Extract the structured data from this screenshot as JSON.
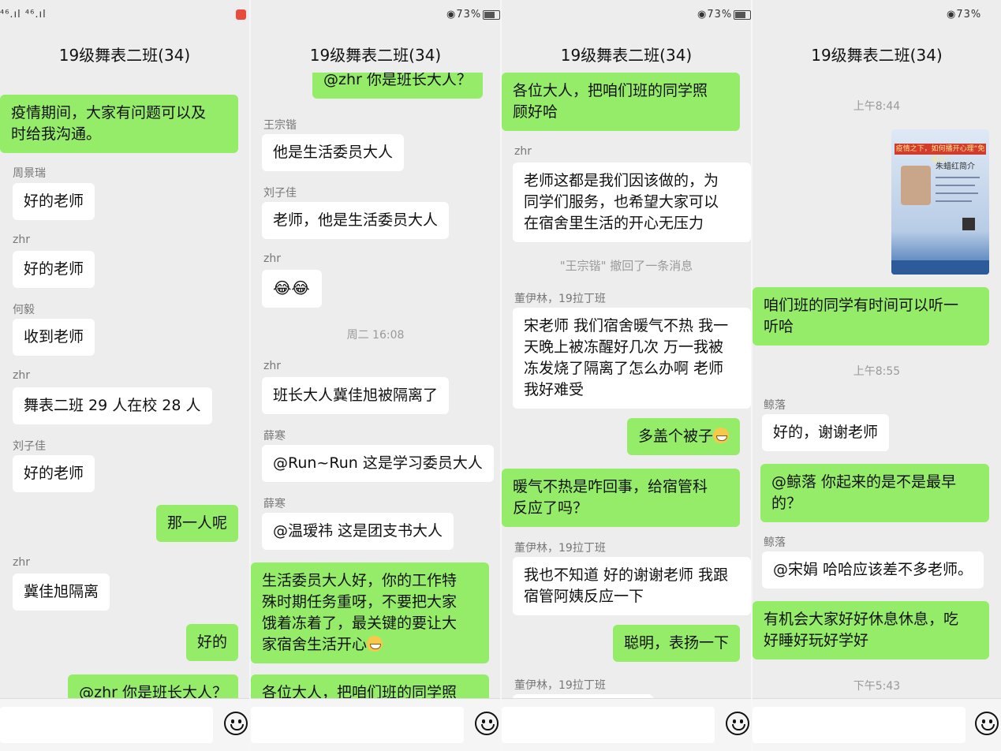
{
  "status_bar": {
    "signal_left": "⁴⁶.ıl ⁴⁶.ıl",
    "battery_pct": "73%"
  },
  "chat_title": "19级舞表二班(34)",
  "panel1": {
    "msg1": "疫情期间，大家有问题可以及",
    "msg1b": "时给我沟通。",
    "n1": "周景瑞",
    "m2": "好的老师",
    "n2": "zhr",
    "m3": "好的老师",
    "n3": "何毅",
    "m4": "收到老师",
    "n4": "zhr",
    "m5": "舞表二班 29 人在校 28 人",
    "n5": "刘子佳",
    "m6": "好的老师",
    "m7": "那一人呢",
    "n6": "zhr",
    "m8": "冀佳旭隔离",
    "m9": "好的",
    "m10": "@zhr  你是班长大人？"
  },
  "panel2": {
    "m1": "@zhr  你是班长大人？",
    "n1": "王宗锴",
    "m2": "他是生活委员大人",
    "n2": "刘子佳",
    "m3": "老师，他是生活委员大人",
    "n3": "zhr",
    "time1": "周二 16:08",
    "n4": "zhr",
    "m5": "班长大人冀佳旭被隔离了",
    "n5": "薛寒",
    "m6": "@Run~Run  这是学习委员大人",
    "n6": "薛寒",
    "m7": "@温瑷祎  这是团支书大人",
    "m8a": "生活委员大人好，你的工作特",
    "m8b": "殊时期任务重呀，不要把大家",
    "m8c": "饿着冻着了，最关键的要让大",
    "m8d": "家宿舍生活开心",
    "m9": "各位大人，把咱们班的同学照"
  },
  "panel3": {
    "m1a": "各位大人，把咱们班的同学照",
    "m1b": "顾好哈",
    "n1": "zhr",
    "m2a": "老师这都是我们因该做的，为",
    "m2b": "同学们服务，也希望大家可以",
    "m2c": "在宿舍里生活的开心无压力",
    "notice": "\"王宗锴\" 撤回了一条消息",
    "n2": "董伊林，19拉丁班",
    "m3a": "宋老师 我们宿舍暖气不热 我一",
    "m3b": "天晚上被冻醒好几次 万一我被",
    "m3c": "冻发烧了隔离了怎么办啊 老师",
    "m3d": "我好难受",
    "m4": "多盖个被子",
    "m5a": "暖气不热是咋回事，给宿管科",
    "m5b": "反应了吗？",
    "n3": "董伊林，19拉丁班",
    "m6a": "我也不知道 好的谢谢老师 我跟",
    "m6b": "宿管阿姨反应一下",
    "m7": "聪明，表扬一下",
    "n4": "董伊林，19拉丁班"
  },
  "panel4": {
    "time1": "上午8:44",
    "poster_title": "疫情之下，如何播开心理“免疫力”",
    "poster_name": "朱蜡红简介",
    "m1a": "咱们班的同学有时间可以听一",
    "m1b": "听哈",
    "time2": "上午8:55",
    "n1": "鲸落",
    "m2": "好的，谢谢老师",
    "m3a": "@鲸落  你起来的是不是最早",
    "m3b": "的？",
    "n2": "鲸落",
    "m4": "@宋娟  哈哈应该差不多老师。",
    "m5a": "有机会大家好好休息休息，吃",
    "m5b": "好睡好玩好学好",
    "time3": "下午5:43"
  },
  "colors": {
    "my_bubble": "#95ec69",
    "their_bubble": "#ffffff",
    "background": "#ededed"
  }
}
